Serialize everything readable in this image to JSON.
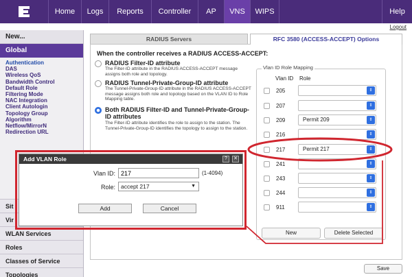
{
  "topnav": {
    "logo_icon": "extreme-logo-icon",
    "tabs": [
      {
        "label": "Home"
      },
      {
        "label": "Logs"
      },
      {
        "label": "Reports"
      },
      {
        "label": "Controller"
      },
      {
        "label": "AP"
      },
      {
        "label": "VNS",
        "active": true
      },
      {
        "label": "WIPS"
      }
    ],
    "help": "Help",
    "logout": "Logout",
    "brand_color": "#4a2c7a"
  },
  "sidebar": {
    "new": "New...",
    "global": "Global",
    "sub_items": [
      "Authentication",
      "DAS",
      "Wireless QoS",
      "Bandwidth Control",
      "Default Role",
      "Filtering Mode",
      "NAC Integration",
      "Client Autologin",
      "Topology Group",
      "Algorithm",
      "Netflow/MirrorN",
      "Redirection URL"
    ],
    "sections": [
      {
        "label": "Sit"
      },
      {
        "label": "Vir"
      },
      {
        "label": "WLAN Services"
      },
      {
        "label": "Roles"
      },
      {
        "label": "Classes of Service"
      },
      {
        "label": "Topologies"
      }
    ]
  },
  "main": {
    "tabs": [
      {
        "label": "RADIUS Servers"
      },
      {
        "label": "RFC 3580 (ACCESS-ACCEPT) Options",
        "active": true
      }
    ],
    "question": "When the controller receives a RADIUS ACCESS-ACCEPT:",
    "options": [
      {
        "title": "RADIUS Filter-ID attribute",
        "desc": "The Filter-ID attribute in the RADIUS ACCESS-ACCEPT message assigns both role and topology.",
        "selected": false
      },
      {
        "title": "RADIUS Tunnel-Private-Group-ID attribute",
        "desc": "The Tunnel-Private-Group-ID attribute in the RADIUS ACCESS-ACCEPT message assigns both role and topology based on the VLAN ID to Role Mapping table.",
        "selected": false
      },
      {
        "title": "Both RADIUS Filter-ID and Tunnel-Private-Group-ID attributes",
        "desc": "The Filter-ID attribute identifies the role to assign to the station. The Tunnel-Private-Group-ID identifies the topology to assign to the station.",
        "selected": true
      }
    ],
    "mapping": {
      "legend": "Vlan ID Role Mapping",
      "col_vlan": "Vlan ID",
      "col_role": "Role",
      "rows": [
        {
          "vlan": "205",
          "role": ""
        },
        {
          "vlan": "207",
          "role": ""
        },
        {
          "vlan": "209",
          "role": "Permit 209"
        },
        {
          "vlan": "216",
          "role": ""
        },
        {
          "vlan": "217",
          "role": "Permit 217"
        },
        {
          "vlan": "241",
          "role": ""
        },
        {
          "vlan": "243",
          "role": ""
        },
        {
          "vlan": "244",
          "role": ""
        },
        {
          "vlan": "911",
          "role": ""
        }
      ],
      "new_label": "New",
      "delete_label": "Delete Selected"
    },
    "save_label": "Save"
  },
  "dialog": {
    "title": "Add VLAN Role",
    "help_icon": "?",
    "close_icon": "✕",
    "vlan_id_label": "Vlan ID:",
    "vlan_id_value": "217",
    "vlan_range": "(1-4094)",
    "role_label": "Role:",
    "role_value": "accept 217",
    "add_label": "Add",
    "cancel_label": "Cancel"
  },
  "highlight_color": "#d0262f"
}
